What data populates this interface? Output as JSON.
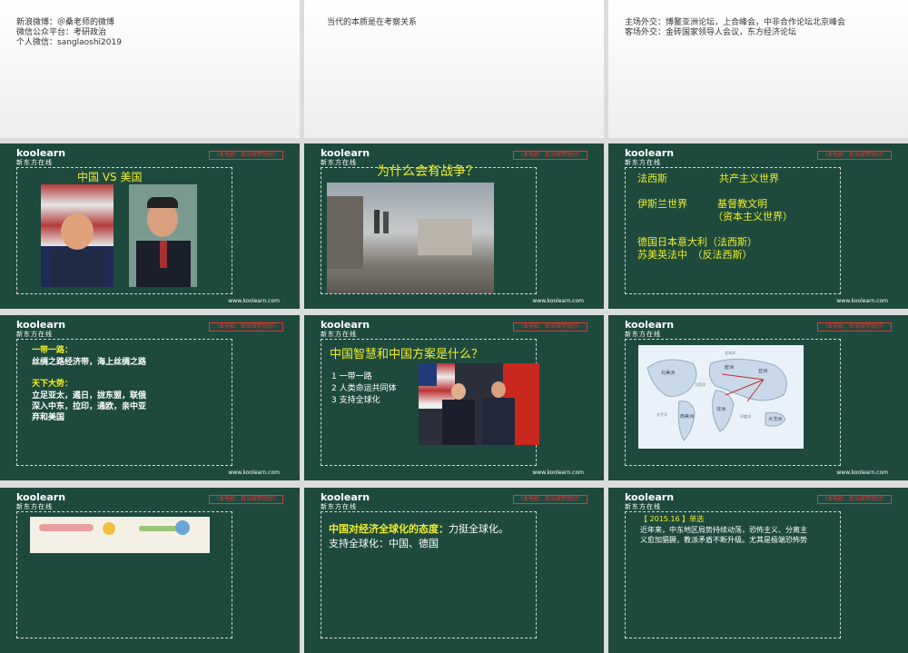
{
  "slides": {
    "s1": {
      "lines": [
        "新浪微博：＠桑老师的微博",
        "微信公众平台：考研政治",
        "个人微信：sanglaoshi2019"
      ]
    },
    "s2": {
      "lines": [
        "当代的本质是在考察关系"
      ]
    },
    "s3": {
      "lines": [
        "主场外交：博鳌亚洲论坛，上合峰会，中非合作论坛北京峰会",
        "客场外交：金砖国家领导人会议，东方经济论坛"
      ]
    },
    "brand": {
      "name": "koolearn",
      "sub": "新东方在线",
      "tag": "（本电影：就当做梦就好）",
      "url": "www.koolearn.com"
    },
    "s4": {
      "title": "中国 VS 美国"
    },
    "s5": {
      "title": "为什么会有战争？"
    },
    "s6": {
      "l1a": "法西斯",
      "l1b": "共产主义世界",
      "l2a": "伊斯兰世界",
      "l2b": "基督教文明",
      "l2c": "（资本主义世界）",
      "l3": "德国日本意大利（法西斯）",
      "l4": "苏美英法中　（反法西斯）"
    },
    "s7": {
      "h1": "一带一路：",
      "b1": "丝绸之路经济带，海上丝绸之路",
      "h2": "天下大势：",
      "b2": [
        "立足亚太，遏日，拢东盟，联俄",
        "深入中东，拉印，通欧，亲中亚",
        "弃和美国"
      ]
    },
    "s8": {
      "title": "中国智慧和中国方案是什么？",
      "items": [
        "1  一带一路",
        "2  人类命运共同体",
        "3  支持全球化"
      ]
    },
    "s9": {
      "map_labels": [
        "北美洲",
        "欧洲",
        "亚洲",
        "非洲",
        "南美洲",
        "大洋洲",
        "北冰洋",
        "大西洋",
        "太平洋",
        "印度洋"
      ]
    },
    "s11": {
      "h": "中国对经济全球化的态度：",
      "v": "力挺全球化。",
      "l2": "支持全球化：中国、德国"
    },
    "s12": {
      "tag": "【 2015.16 】单选",
      "l1": "近年来，中东地区局势持续动荡，恐怖主义、分离主",
      "l2": "义愈加猖獗，教派矛盾不断升级。尤其是极端恐怖势"
    }
  }
}
